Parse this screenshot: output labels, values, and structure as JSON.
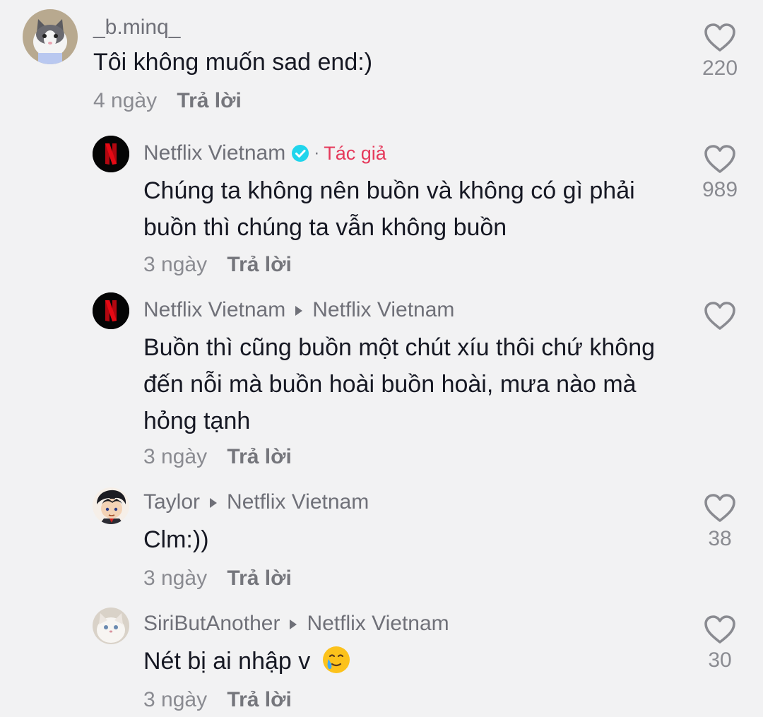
{
  "comments": [
    {
      "username": "_b.minq_",
      "text": "Tôi không muốn sad end:)",
      "time": "4 ngày",
      "reply": "Trả lời",
      "likes": "220"
    },
    {
      "username": "Netflix Vietnam",
      "verified": true,
      "separator": "·",
      "author_tag": "Tác giả",
      "text": "Chúng ta không nên buồn và không có gì phải buồn thì chúng ta vẫn không buồn",
      "time": "3 ngày",
      "reply": "Trả lời",
      "likes": "989"
    },
    {
      "username": "Netflix Vietnam",
      "reply_to": "Netflix Vietnam",
      "text": "Buồn thì cũng buồn một chút xíu thôi chứ không đến nỗi mà buồn hoài buồn hoài, mưa nào mà hỏng tạnh",
      "time": "3 ngày",
      "reply": "Trả lời",
      "likes": ""
    },
    {
      "username": "Taylor",
      "reply_to": "Netflix Vietnam",
      "text": "Clm:))",
      "time": "3 ngày",
      "reply": "Trả lời",
      "likes": "38"
    },
    {
      "username": "SiriButAnother",
      "reply_to": "Netflix Vietnam",
      "text": "Nét bị ai nhập v",
      "emoji": "crying-smile-emoji",
      "time": "3 ngày",
      "reply": "Trả lời",
      "likes": "30"
    }
  ],
  "colors": {
    "background": "#f2f2f3",
    "author_tag": "#e5395b",
    "verified": "#20d5ec",
    "netflix_red": "#e50914"
  }
}
